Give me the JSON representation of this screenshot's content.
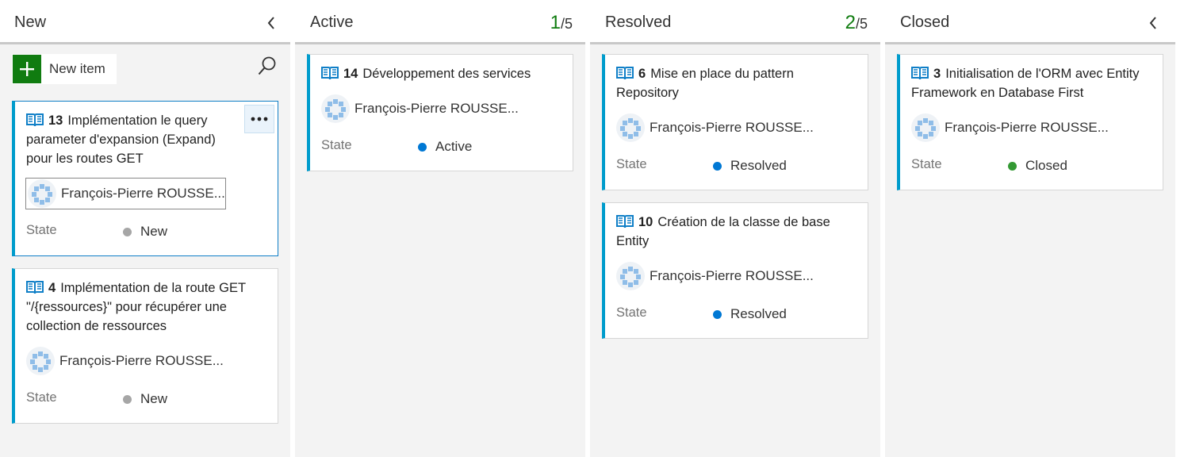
{
  "colors": {
    "new_dot": "#a6a6a6",
    "active_dot": "#0078d4",
    "resolved_dot": "#0078d4",
    "closed_dot": "#339933",
    "card_accent": "#009ccc",
    "count_green": "#107c10"
  },
  "columns": {
    "new": {
      "title": "New",
      "new_item_label": "New item",
      "cards": [
        {
          "id": "13",
          "title": "Implémentation le query parameter d'expansion (Expand)  pour les routes GET",
          "assignee": "François-Pierre ROUSSE...",
          "state_label": "State",
          "state": "New",
          "icon": "book-icon"
        },
        {
          "id": "4",
          "title": "Implémentation de la route GET \"/{ressources}\" pour récupérer une collection de ressources",
          "assignee": "François-Pierre ROUSSE...",
          "state_label": "State",
          "state": "New",
          "icon": "book-icon"
        }
      ]
    },
    "active": {
      "title": "Active",
      "count": "1",
      "limit": "/5",
      "cards": [
        {
          "id": "14",
          "title": "Développement des services",
          "assignee": "François-Pierre ROUSSE...",
          "state_label": "State",
          "state": "Active",
          "icon": "book-icon"
        }
      ]
    },
    "resolved": {
      "title": "Resolved",
      "count": "2",
      "limit": "/5",
      "cards": [
        {
          "id": "6",
          "title": "Mise en place du pattern Repository",
          "assignee": "François-Pierre ROUSSE...",
          "state_label": "State",
          "state": "Resolved",
          "icon": "book-icon"
        },
        {
          "id": "10",
          "title": "Création de la classe de base Entity",
          "assignee": "François-Pierre ROUSSE...",
          "state_label": "State",
          "state": "Resolved",
          "icon": "book-icon"
        }
      ]
    },
    "closed": {
      "title": "Closed",
      "cards": [
        {
          "id": "3",
          "title": "Initialisation de l'ORM avec Entity Framework en Database First",
          "assignee": "François-Pierre ROUSSE...",
          "state_label": "State",
          "state": "Closed",
          "icon": "book-icon"
        }
      ]
    }
  }
}
